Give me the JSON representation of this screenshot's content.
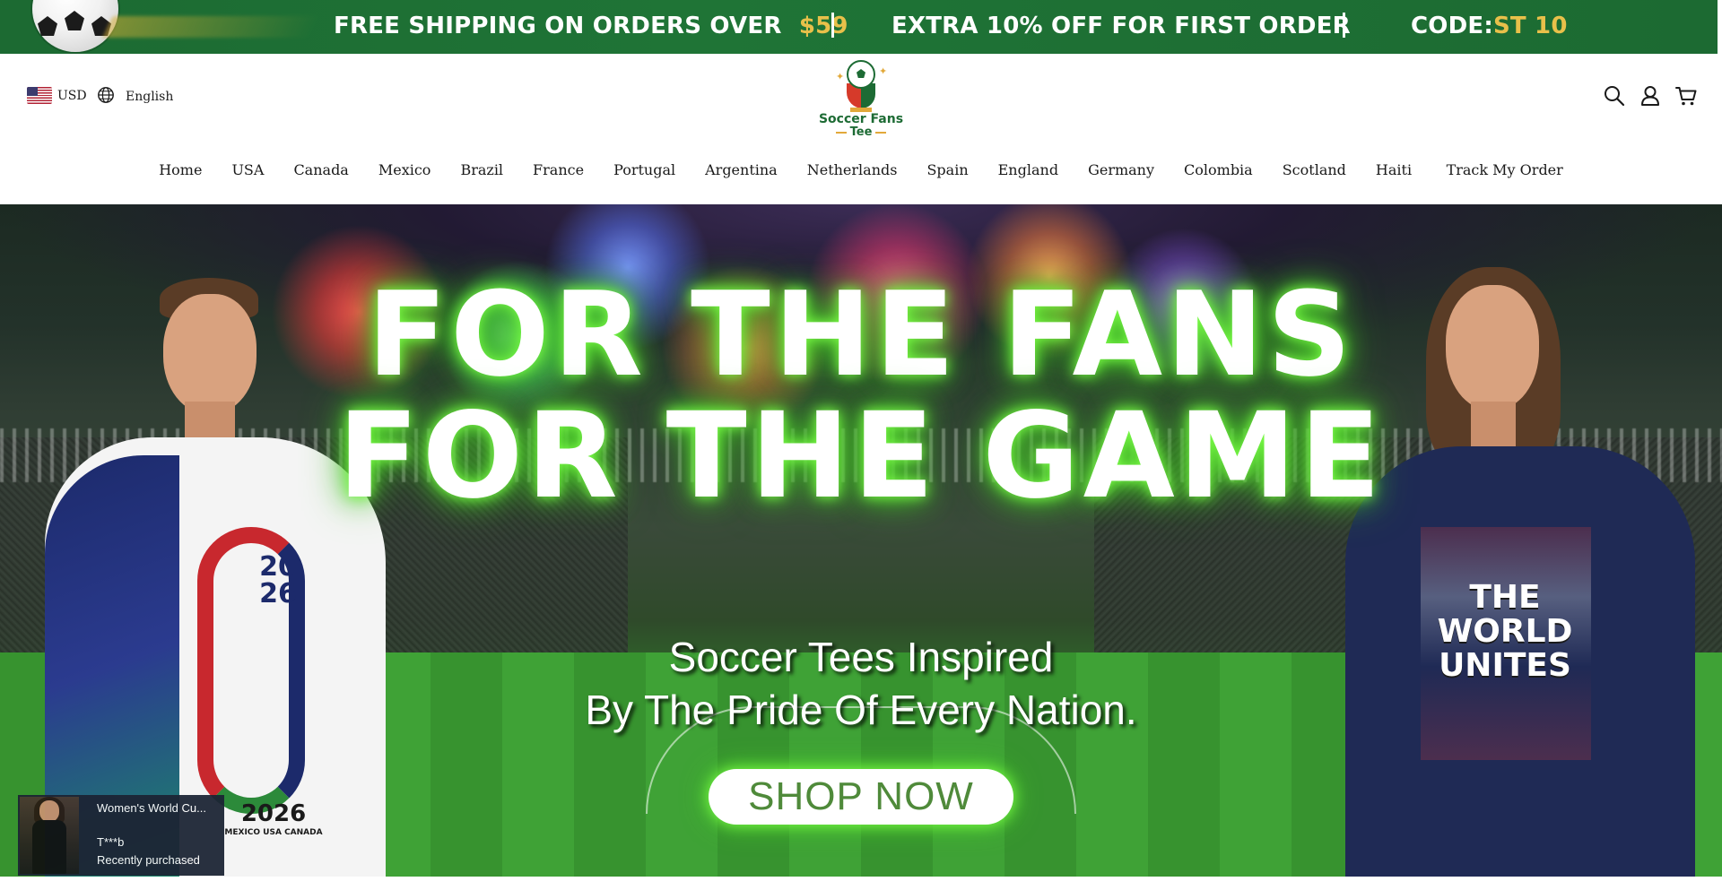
{
  "announcement": {
    "part1_text": "FREE SHIPPING ON ORDERS OVER",
    "part1_amount": "$59",
    "part2_text": "EXTRA 10% OFF FOR FIRST ORDER",
    "part3_text": "CODE:",
    "part3_code": "ST 10",
    "bar_color": "#1f7436",
    "accent_color": "#e8c04a"
  },
  "header": {
    "currency": "USD",
    "language": "English",
    "logo_line1": "Soccer Fans",
    "logo_line2": "Tee",
    "icons": [
      "search-icon",
      "account-icon",
      "cart-icon"
    ]
  },
  "nav": {
    "items": [
      "Home",
      "USA",
      "Canada",
      "Mexico",
      "Brazil",
      "France",
      "Portugal",
      "Argentina",
      "Netherlands",
      "Spain",
      "England",
      "Germany",
      "Colombia",
      "Scotland",
      "Haiti",
      "Track My Order"
    ]
  },
  "hero": {
    "headline_1": "FOR THE FANS",
    "headline_2": "FOR THE GAME",
    "sub_1": "Soccer Tees Inspired",
    "sub_2": "By The Pride Of Every Nation.",
    "cta": "SHOP NOW",
    "glow_color": "#4bd12a",
    "left_shirt_text_1": "20",
    "left_shirt_text_2": "26",
    "left_shirt_text_3": "2026",
    "left_shirt_text_4": "MEXICO USA CANADA",
    "right_shirt_text": "THE WORLD UNITES"
  },
  "popup": {
    "product": "Women's World Cu...",
    "buyer": "T***b",
    "status": "Recently purchased"
  }
}
